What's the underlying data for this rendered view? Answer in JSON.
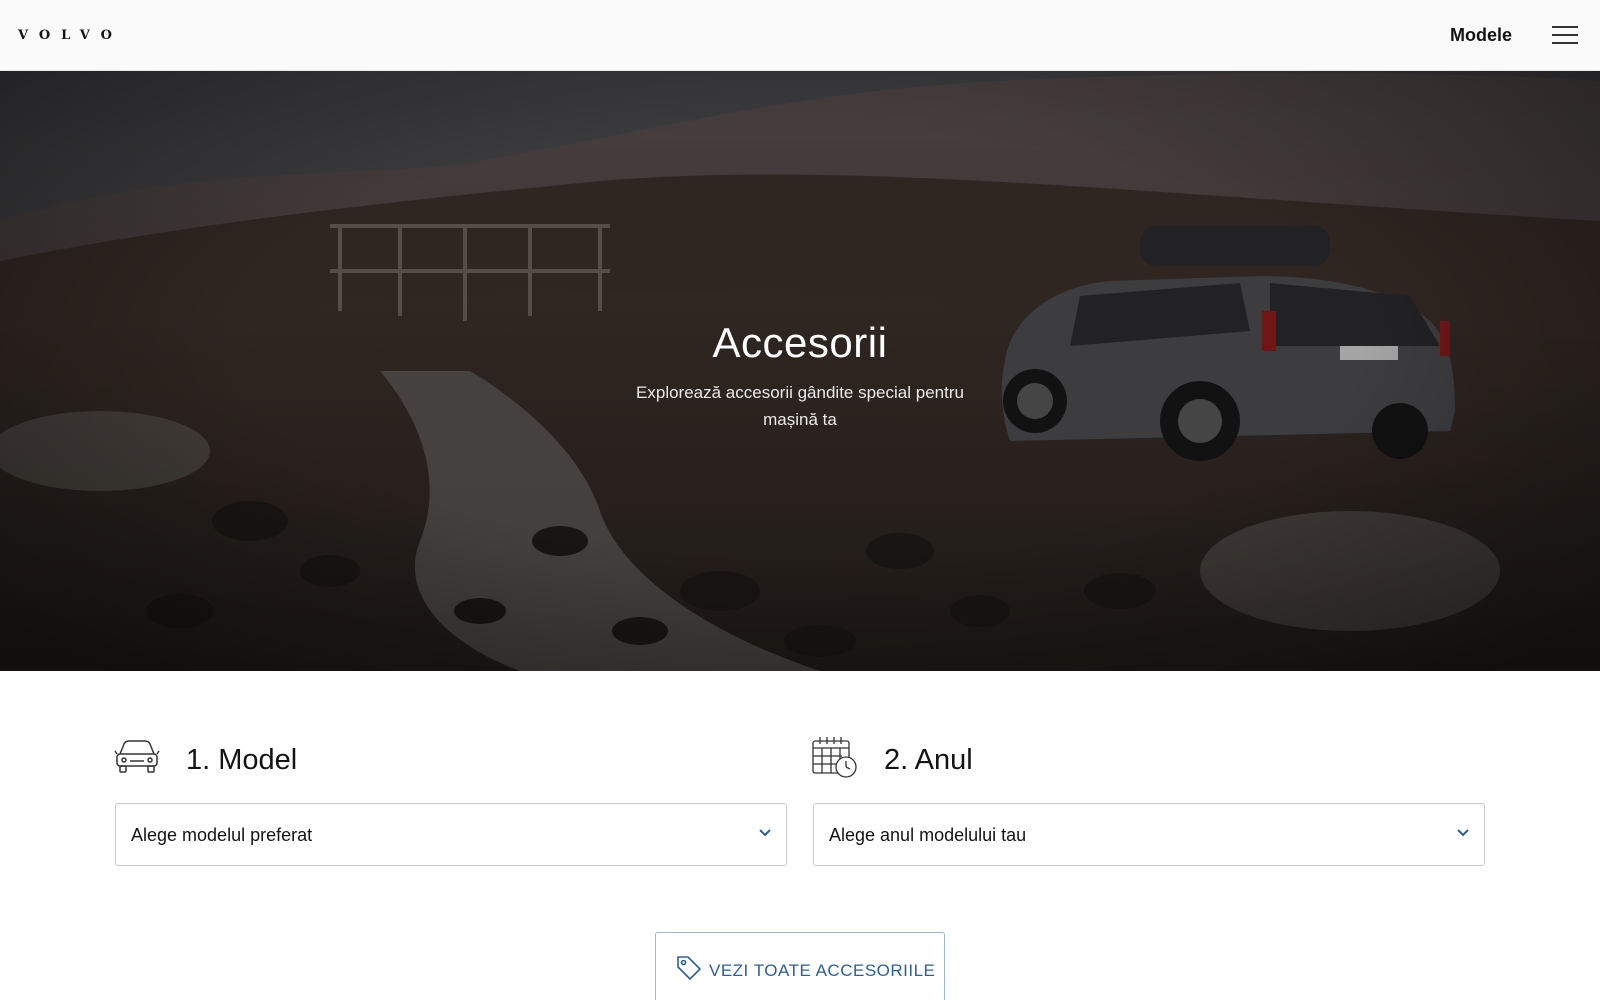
{
  "header": {
    "logo": "VOLVO",
    "nav_link": "Modele"
  },
  "hero": {
    "title": "Accesorii",
    "subtitle": "Explorează accesorii gândite special pentru mașină ta"
  },
  "steps": {
    "model": {
      "title": "1. Model",
      "placeholder": "Alege modelul preferat",
      "icon": "car-icon"
    },
    "year": {
      "title": "2. Anul",
      "placeholder": "Alege anul modelului tau",
      "icon": "calendar-clock-icon"
    }
  },
  "cta": {
    "label": "VEZI TOATE ACCESORIILE",
    "icon": "tag-icon"
  },
  "colors": {
    "accent": "#2a5f9e",
    "text": "#141414",
    "border": "#c8c8c8"
  }
}
